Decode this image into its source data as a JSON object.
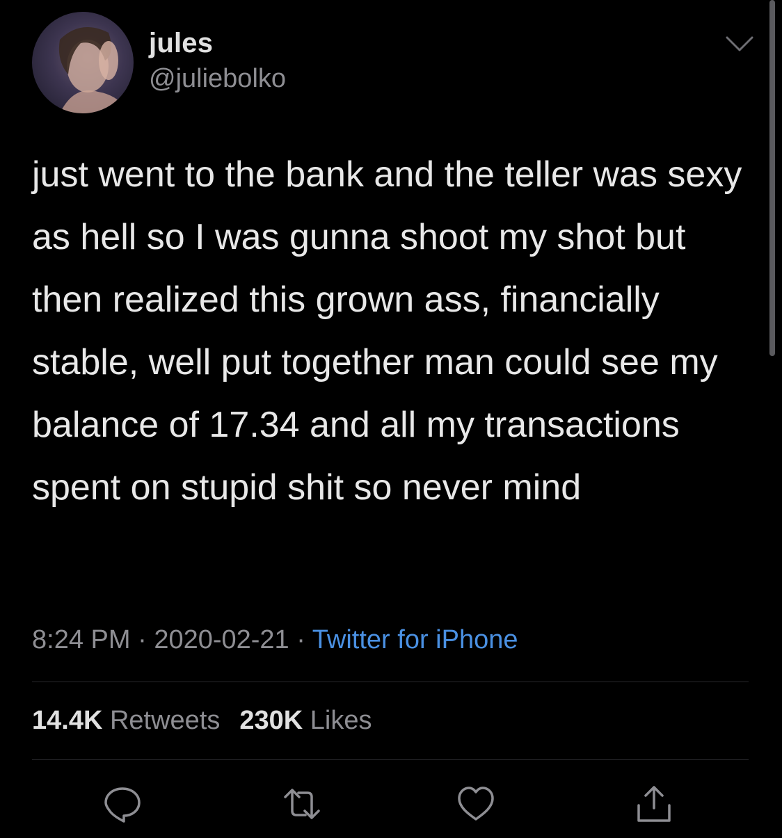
{
  "user": {
    "name": "jules",
    "handle": "@juliebolko"
  },
  "tweet": {
    "text": "just went to the bank and the teller was sexy as hell so I was gunna shoot my shot but then realized this grown ass, financially stable, well put together man could see my balance of 17.34 and all my transactions spent on stupid shit so never mind",
    "time": "8:24 PM",
    "separator": "·",
    "date": "2020-02-21",
    "source": "Twitter for iPhone"
  },
  "stats": {
    "retweets_count": "14.4K",
    "retweets_label": "Retweets",
    "likes_count": "230K",
    "likes_label": "Likes"
  },
  "actions": {
    "reply_icon": "speech-bubble-icon",
    "retweet_icon": "retweet-arrows-icon",
    "like_icon": "heart-icon",
    "share_icon": "share-upload-icon"
  },
  "colors": {
    "background": "#000000",
    "text": "#e8e8e8",
    "secondary": "#8e8e93",
    "link": "#4a90e2"
  }
}
